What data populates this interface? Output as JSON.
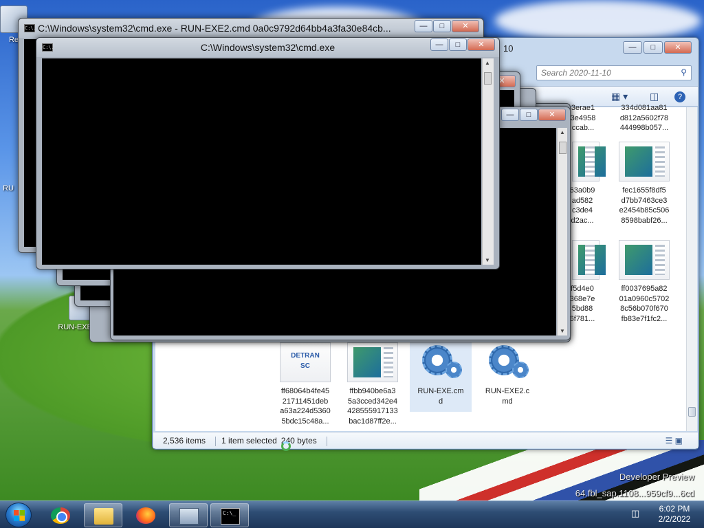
{
  "desktop": {
    "watermark_line1": "Developer Preview",
    "watermark_line2": "64.fbl_sap.1108...959cf9...6cd",
    "icons": [
      {
        "label": "Re"
      },
      {
        "label": "RUN-EXE.c..."
      },
      {
        "label": "RU"
      }
    ]
  },
  "explorer": {
    "search_placeholder": "Search 2020-11-10",
    "caption_label_partial": "10",
    "files": [
      {
        "name_lines": [
          "3erae1",
          "3e4958",
          "ccab..."
        ]
      },
      {
        "name_lines": [
          "334d081aa81",
          "d812a5602f78",
          "444998b057..."
        ]
      },
      {
        "name_lines": [
          "63a0b9",
          "ad582",
          "c3de4",
          "d2ac..."
        ]
      },
      {
        "name_lines": [
          "fec1655f8df5",
          "d7bb7463ce3",
          "e2454b85c506",
          "8598babf26..."
        ]
      },
      {
        "name_lines": [
          "f5d4e0",
          "368e7e",
          "5bd88",
          "6f781..."
        ]
      },
      {
        "name_lines": [
          "ff0037695a82",
          "01a0960c5702",
          "8c56b070f670",
          "fb83e7f1fc2..."
        ]
      },
      {
        "name_lines": [
          "ff68064b4fe45",
          "21711451deb",
          "a63a224d5360",
          "5bdc15c48a..."
        ],
        "thumb_text": "DETRAN SC"
      },
      {
        "name_lines": [
          "ffbb940be6a3",
          "5a3cced342e4",
          "428555917133",
          "bac1d87ff2e..."
        ]
      },
      {
        "name_lines": [
          "RUN-EXE.cm",
          "d"
        ]
      },
      {
        "name_lines": [
          "RUN-EXE2.c",
          "md"
        ]
      }
    ],
    "status": {
      "items_count": "2,536 items",
      "selected": "1 item selected",
      "size": "240 bytes"
    }
  },
  "cmd_windows": {
    "back_title": "C:\\Windows\\system32\\cmd.exe - RUN-EXE2.cmd   0a0c9792d64bb4a3fa30e84cb...",
    "front_title": "C:\\Windows\\system32\\cmd.exe",
    "icon_text": "C:\\."
  },
  "taskbar": {
    "apps": [
      {
        "name": "chrome"
      },
      {
        "name": "explorer"
      },
      {
        "name": "firefox"
      },
      {
        "name": "task-manager"
      },
      {
        "name": "cmd",
        "text": "C:\\_"
      }
    ],
    "time": "6:02 PM",
    "date": "2/2/2022"
  },
  "colors": {
    "console_bg": "#000000",
    "taskbar": "#2e4d74",
    "explorer_frame": "#c7d9ee"
  }
}
